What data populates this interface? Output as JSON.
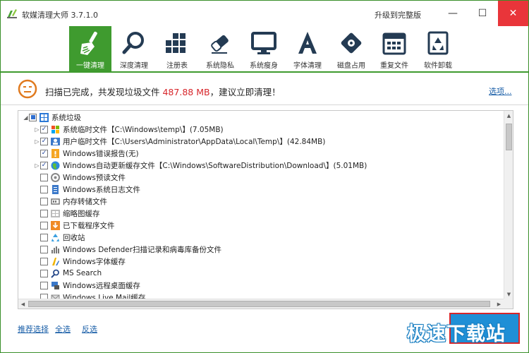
{
  "window": {
    "title": "软媒清理大师 3.7.1.0",
    "upgrade_label": "升级到完整版",
    "controls": {
      "minimize": "—",
      "maximize": "☐",
      "close": "✕"
    }
  },
  "toolbar": {
    "items": [
      {
        "label": "一键清理",
        "icon": "broom-icon",
        "active": true
      },
      {
        "label": "深度清理",
        "icon": "magnifier-icon",
        "active": false
      },
      {
        "label": "注册表",
        "icon": "blocks-icon",
        "active": false
      },
      {
        "label": "系统隐私",
        "icon": "eraser-icon",
        "active": false
      },
      {
        "label": "系统瘦身",
        "icon": "monitor-icon",
        "active": false
      },
      {
        "label": "字体清理",
        "icon": "font-icon",
        "active": false
      },
      {
        "label": "磁盘占用",
        "icon": "disk-icon",
        "active": false
      },
      {
        "label": "重复文件",
        "icon": "calendar-icon",
        "active": false
      },
      {
        "label": "软件卸载",
        "icon": "recycle-icon",
        "active": false
      }
    ]
  },
  "status": {
    "prefix": "扫描已完成，共发现垃圾文件 ",
    "size": "487.88 MB",
    "suffix": "，建议立即清理！",
    "options_label": "选项..."
  },
  "tree": {
    "root": {
      "label": "系统垃圾",
      "expanded": true,
      "state": "partial"
    },
    "items": [
      {
        "label": "系统临时文件【C:\\Windows\\temp\\】(7.05MB)",
        "checked": true,
        "expandable": true,
        "icon": "windows-flag-icon"
      },
      {
        "label": "用户临时文件【C:\\Users\\Administrator\\AppData\\Local\\Temp\\】(42.84MB)",
        "checked": true,
        "expandable": true,
        "icon": "user-icon"
      },
      {
        "label": "Windows错误报告(无)",
        "checked": true,
        "expandable": false,
        "icon": "warning-icon"
      },
      {
        "label": "Windows自动更新缓存文件【C:\\Windows\\SoftwareDistribution\\Download\\】(5.01MB)",
        "checked": true,
        "expandable": true,
        "icon": "globe-icon"
      },
      {
        "label": "Windows预读文件",
        "checked": false,
        "expandable": false,
        "icon": "gear-drive-icon"
      },
      {
        "label": "Windows系统日志文件",
        "checked": false,
        "expandable": false,
        "icon": "log-icon"
      },
      {
        "label": "内存转储文件",
        "checked": false,
        "expandable": false,
        "icon": "memory-icon"
      },
      {
        "label": "缩略图缓存",
        "checked": false,
        "expandable": false,
        "icon": "thumbnail-icon"
      },
      {
        "label": "已下载程序文件",
        "checked": false,
        "expandable": false,
        "icon": "download-icon"
      },
      {
        "label": "回收站",
        "checked": false,
        "expandable": false,
        "icon": "recycle-bin-icon"
      },
      {
        "label": "Windows Defender扫描记录和病毒库备份文件",
        "checked": false,
        "expandable": false,
        "icon": "defender-icon"
      },
      {
        "label": "Windows字体缓存",
        "checked": false,
        "expandable": false,
        "icon": "font-cache-icon"
      },
      {
        "label": "MS Search",
        "checked": false,
        "expandable": false,
        "icon": "search-icon"
      },
      {
        "label": "Windows远程桌面缓存",
        "checked": false,
        "expandable": false,
        "icon": "remote-desktop-icon"
      },
      {
        "label": "Windows Live Mail缓存",
        "checked": false,
        "expandable": false,
        "icon": "mail-icon"
      }
    ]
  },
  "bottom": {
    "recommend_label": "推荐选择",
    "select_all_label": "全选",
    "invert_label": "反选"
  },
  "watermark": "极速下载站",
  "colors": {
    "accent_green": "#3f9b2f",
    "highlight_red": "#d7262b",
    "link_blue": "#1a5fa8",
    "close_red": "#e9353a",
    "button_blue": "#1f8fd6"
  }
}
